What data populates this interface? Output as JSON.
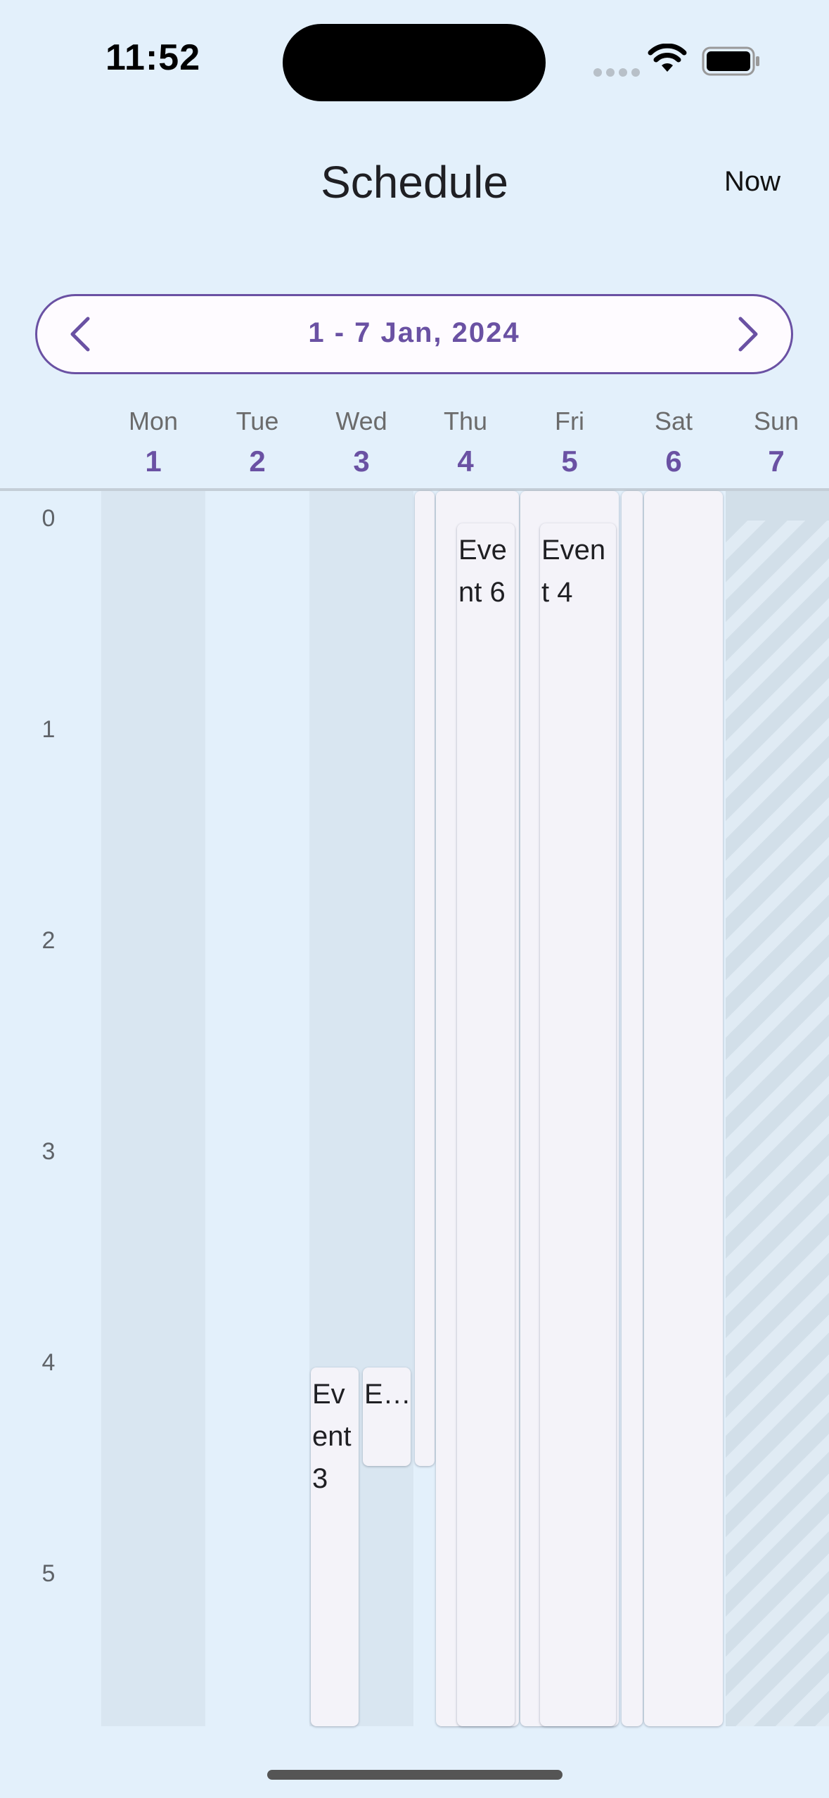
{
  "status_bar": {
    "time": "11:52"
  },
  "app_bar": {
    "title": "Schedule",
    "now_label": "Now"
  },
  "date_nav": {
    "range": "1 - 7 Jan, 2024"
  },
  "days": [
    {
      "name": "Mon",
      "num": "1"
    },
    {
      "name": "Tue",
      "num": "2"
    },
    {
      "name": "Wed",
      "num": "3"
    },
    {
      "name": "Thu",
      "num": "4"
    },
    {
      "name": "Fri",
      "num": "5"
    },
    {
      "name": "Sat",
      "num": "6"
    },
    {
      "name": "Sun",
      "num": "7"
    }
  ],
  "hours": [
    "0",
    "1",
    "2",
    "3",
    "4",
    "5"
  ],
  "events": [
    {
      "label": "Eve\nnt 6"
    },
    {
      "label": "Even\nt 4"
    },
    {
      "label": "Ev\nent\n3"
    },
    {
      "label": "E…"
    }
  ],
  "colors": {
    "accent": "#6a51a3",
    "background": "#e3f0fb",
    "event_bg": "#f4f3f9"
  }
}
